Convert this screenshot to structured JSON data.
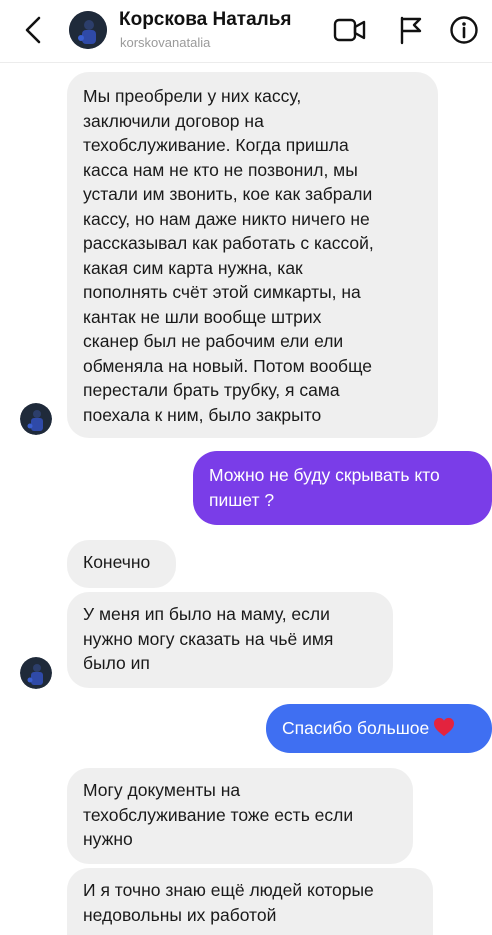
{
  "header": {
    "contact_name": "Корскова Наталья",
    "contact_username": "korskovanatalia",
    "icons": {
      "back": "chevron-left-icon",
      "video": "video-camera-icon",
      "flag": "flag-icon",
      "info": "info-icon"
    }
  },
  "colors": {
    "incoming_bubble": "#efefef",
    "outgoing_bubble_purple": "#7f3be6",
    "outgoing_bubble_blue": "#3f6ff2",
    "heart": "#e3233e",
    "username_gray": "#9a9a9a"
  },
  "messages": [
    {
      "direction": "incoming",
      "text": "Мы преобрели у них кассу,\nзаключили договор на\nтехобслуживание. Когда пришла\nкасса нам не кто не позвонил, мы\nустали им звонить, кое как забрали\nкассу, но нам даже никто ничего не\nрассказывал как работать с кассой,\nкакая сим карта нужна, как\nпополнять счёт этой симкарты, на\nкантак не шли вообще штрих\nсканер был не рабочим ели ели\nобменяла на новый. Потом вообще\nперестали брать трубку, я сама\nпоехала к ним, было закрыто"
    },
    {
      "direction": "outgoing",
      "text": "Можно не буду скрывать кто\nпишет ?"
    },
    {
      "direction": "incoming",
      "text": "Конечно"
    },
    {
      "direction": "incoming",
      "text": "У меня ип было на маму, если\nнужно могу сказать на чьё имя\nбыло ип"
    },
    {
      "direction": "outgoing",
      "text": "Спасибо большое",
      "emoji": "heart-icon"
    },
    {
      "direction": "incoming",
      "text": "Могу документы на\nтехобслуживание тоже есть если\nнужно"
    },
    {
      "direction": "incoming",
      "text": "И я точно знаю ещё людей которые\nнедовольны их работой"
    }
  ]
}
